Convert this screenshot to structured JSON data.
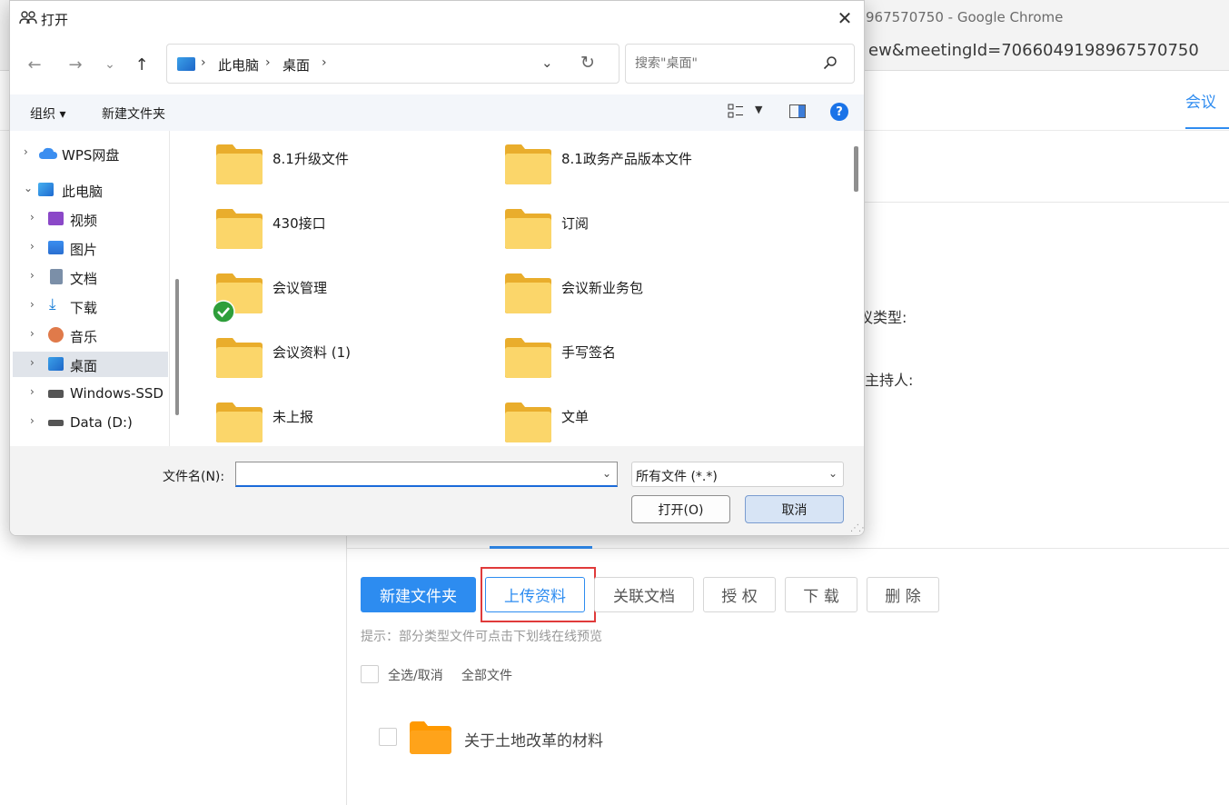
{
  "browser": {
    "title_fragment": "967570750 - Google Chrome",
    "url_fragment": "ew&meetingId=7066049198967570750",
    "header_tab": "会议"
  },
  "page": {
    "label_type": "议类型:",
    "label_host": "主持人:",
    "buttons": {
      "new_folder": "新建文件夹",
      "upload": "上传资料",
      "link_doc": "关联文档",
      "authorize": "授 权",
      "download": "下 载",
      "delete": "删 除"
    },
    "hint": "提示：部分类型文件可点击下划线在线预览",
    "select_all": "全选/取消",
    "all_files": "全部文件",
    "file_items": [
      {
        "name": "关于土地改革的材料"
      }
    ]
  },
  "dialog": {
    "title": "打开",
    "close_glyph": "✕",
    "nav": {
      "back": "←",
      "forward": "→",
      "recent": "⌄",
      "up": "↑"
    },
    "breadcrumbs": [
      "此电脑",
      "桌面"
    ],
    "search_placeholder": "搜索\"桌面\"",
    "commands": {
      "organize": "组织 ▾",
      "new_folder": "新建文件夹"
    },
    "help_glyph": "?",
    "nav_pane": [
      {
        "label": "WPS网盘",
        "icon": "cloud-icon",
        "indent": 0,
        "expanded": false
      },
      {
        "label": "此电脑",
        "icon": "computer-icon",
        "indent": 0,
        "expanded": true
      },
      {
        "label": "视频",
        "icon": "video-icon",
        "indent": 1,
        "expanded": false
      },
      {
        "label": "图片",
        "icon": "picture-icon",
        "indent": 1,
        "expanded": false
      },
      {
        "label": "文档",
        "icon": "document-icon",
        "indent": 1,
        "expanded": false
      },
      {
        "label": "下载",
        "icon": "download-icon",
        "indent": 1,
        "expanded": false
      },
      {
        "label": "音乐",
        "icon": "music-icon",
        "indent": 1,
        "expanded": false
      },
      {
        "label": "桌面",
        "icon": "desktop-icon",
        "indent": 1,
        "expanded": false,
        "selected": true
      },
      {
        "label": "Windows-SSD (",
        "icon": "drive-icon",
        "indent": 1,
        "expanded": false
      },
      {
        "label": "Data (D:)",
        "icon": "drive-icon",
        "indent": 1,
        "expanded": false
      }
    ],
    "folders": [
      {
        "name": "8.1升级文件",
        "synced": false
      },
      {
        "name": "8.1政务产品版本文件",
        "synced": false
      },
      {
        "name": "430接口",
        "synced": false
      },
      {
        "name": "订阅",
        "synced": false
      },
      {
        "name": "会议管理",
        "synced": true
      },
      {
        "name": "会议新业务包",
        "synced": false
      },
      {
        "name": "会议资料 (1)",
        "synced": false
      },
      {
        "name": "手写签名",
        "synced": false
      },
      {
        "name": "未上报",
        "synced": false
      },
      {
        "name": "文单",
        "synced": false
      }
    ],
    "filename_label": "文件名(N):",
    "filename_value": "",
    "filetype": "所有文件 (*.*)",
    "open_button": "打开(O)",
    "cancel_button": "取消"
  },
  "colors": {
    "primary": "#2d8cf0",
    "highlight": "#e03a3a",
    "folder_yellow": "#f8c846",
    "folder_orange": "#ff9900"
  }
}
